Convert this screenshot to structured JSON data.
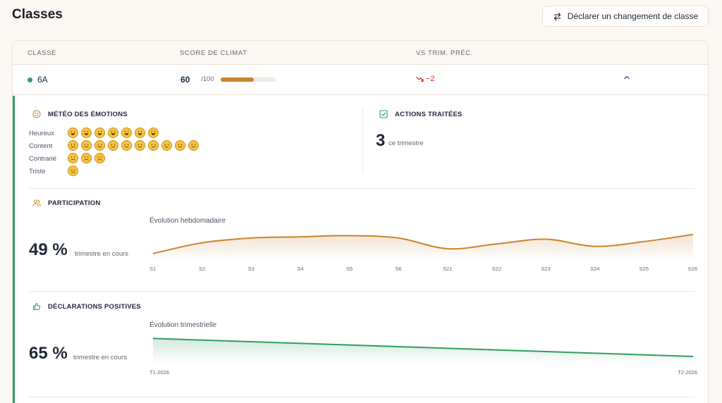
{
  "page": {
    "title": "Classes",
    "change_button_label": "Déclarer un changement de classe"
  },
  "table": {
    "headers": [
      "CLASSE",
      "SCORE DE CLIMAT",
      "VS TRIM. PRÉC."
    ],
    "row": {
      "class_name": "6A",
      "status_color": "#2f9d62",
      "score": "60",
      "score_max": "/100",
      "score_fraction": 0.6,
      "trend_text": "−2",
      "trend_color": "#dc2626"
    }
  },
  "emotions": {
    "title": "MÉTÉO DES ÉMOTIONS",
    "rows": [
      {
        "label": "Heureux",
        "count": 7,
        "face": "😄"
      },
      {
        "label": "Content",
        "count": 10,
        "face": "🙂"
      },
      {
        "label": "Contrarié",
        "count": 3,
        "face": "🙁"
      },
      {
        "label": "Triste",
        "count": 1,
        "face": "😞"
      }
    ]
  },
  "actions": {
    "title": "ACTIONS TRAITÉES",
    "value": "3",
    "note": "ce trimestre"
  },
  "participation": {
    "title": "PARTICIPATION",
    "value": "49 %",
    "note": "trimestre en cours",
    "chart_title": "Évolution hebdomadaire"
  },
  "declarations": {
    "title": "DÉCLARATIONS POSITIVES",
    "value": "65 %",
    "note": "trimestre en cours",
    "chart_title": "Évolution trimestrielle"
  },
  "colors": {
    "accent_orange": "#c8842e",
    "accent_green": "#2f9d62"
  },
  "chart_data": [
    {
      "type": "area",
      "title": "Évolution hebdomadaire",
      "categories": [
        "S1",
        "S2",
        "S3",
        "S4",
        "S5",
        "S6",
        "S21",
        "S22",
        "S23",
        "S24",
        "S25",
        "S26"
      ],
      "values": [
        36,
        45,
        49,
        50,
        51,
        49,
        40,
        44,
        48,
        42,
        46,
        52
      ],
      "ylim": [
        30,
        56
      ],
      "color": "#c8842e"
    },
    {
      "type": "area",
      "title": "Évolution trimestrielle",
      "categories": [
        "T1-2026",
        "T2-2026"
      ],
      "values": [
        72,
        65
      ],
      "ylim": [
        62,
        74
      ],
      "color": "#2f9d62"
    }
  ]
}
